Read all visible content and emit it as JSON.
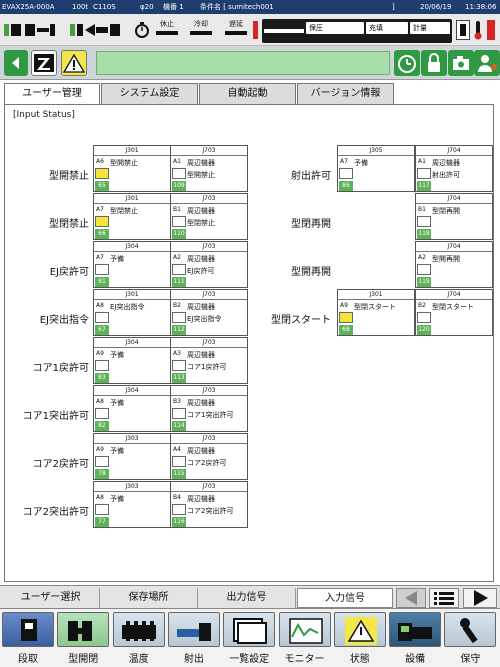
{
  "titlebar": {
    "model": "EVAX25A-000A",
    "size": "100t",
    "controller": "C110S",
    "screw": "φ20",
    "machine": "機番 1",
    "condition": "条件名 [ sumitech001",
    "bracket": "]",
    "date": "20/06/19",
    "time": "11:38:06"
  },
  "status": {
    "process": {
      "pause": "休止",
      "cool": "冷却",
      "delay": "遅延"
    },
    "modes": {
      "hold": "保圧",
      "fill": "充填",
      "meter": "計量"
    }
  },
  "toolbar": {
    "message": "",
    "icons": [
      "back-arrow-icon",
      "z-logo-icon",
      "warning-icon",
      "clock-icon",
      "lock-icon",
      "camera-icon",
      "user-icon"
    ]
  },
  "tabs": [
    {
      "label": "ユーザー管理",
      "active": true
    },
    {
      "label": "システム設定",
      "active": false
    },
    {
      "label": "自動起動",
      "active": false
    },
    {
      "label": "バージョン情報",
      "active": false
    }
  ],
  "section_title": "[Input Status]",
  "rows_left": [
    {
      "label": "型開禁止",
      "a": {
        "conn": "J301",
        "pin": "A6",
        "name": "型開禁止",
        "on": true,
        "num": "65",
        "sub": ""
      },
      "b": {
        "conn": "J703",
        "pin": "A1",
        "name": "周辺機器",
        "on": false,
        "num": "109",
        "sub": "型開禁止"
      }
    },
    {
      "label": "型閉禁止",
      "a": {
        "conn": "J301",
        "pin": "A7",
        "name": "型閉禁止",
        "on": true,
        "num": "66",
        "sub": ""
      },
      "b": {
        "conn": "J703",
        "pin": "B1",
        "name": "周辺機器",
        "on": false,
        "num": "110",
        "sub": "型閉禁止"
      }
    },
    {
      "label": "EJ戻許可",
      "a": {
        "conn": "J304",
        "pin": "A7",
        "name": "予備",
        "on": false,
        "num": "81",
        "sub": ""
      },
      "b": {
        "conn": "J703",
        "pin": "A2",
        "name": "周辺機器",
        "on": false,
        "num": "111",
        "sub": "EJ戻許可"
      }
    },
    {
      "label": "EJ突出指令",
      "a": {
        "conn": "J301",
        "pin": "A8",
        "name": "EJ突出指令",
        "on": false,
        "num": "67",
        "sub": ""
      },
      "b": {
        "conn": "J703",
        "pin": "B2",
        "name": "周辺機器",
        "on": false,
        "num": "112",
        "sub": "EJ突出指令"
      }
    },
    {
      "label": "コア1戻許可",
      "a": {
        "conn": "J304",
        "pin": "A9",
        "name": "予備",
        "on": false,
        "num": "83",
        "sub": ""
      },
      "b": {
        "conn": "J703",
        "pin": "A3",
        "name": "周辺機器",
        "on": false,
        "num": "113",
        "sub": "コア1戻許可"
      }
    },
    {
      "label": "コア1突出許可",
      "a": {
        "conn": "J304",
        "pin": "A8",
        "name": "予備",
        "on": false,
        "num": "82",
        "sub": ""
      },
      "b": {
        "conn": "J703",
        "pin": "B3",
        "name": "周辺機器",
        "on": false,
        "num": "114",
        "sub": "コア1突出許可"
      }
    },
    {
      "label": "コア2戻許可",
      "a": {
        "conn": "J303",
        "pin": "A9",
        "name": "予備",
        "on": false,
        "num": "78",
        "sub": ""
      },
      "b": {
        "conn": "J703",
        "pin": "A4",
        "name": "周辺機器",
        "on": false,
        "num": "115",
        "sub": "コア2戻許可"
      }
    },
    {
      "label": "コア2突出許可",
      "a": {
        "conn": "J303",
        "pin": "A8",
        "name": "予備",
        "on": false,
        "num": "77",
        "sub": ""
      },
      "b": {
        "conn": "J703",
        "pin": "B4",
        "name": "周辺機器",
        "on": false,
        "num": "116",
        "sub": "コア2突出許可"
      }
    }
  ],
  "rows_right": [
    {
      "label": "射出許可",
      "a": {
        "conn": "J305",
        "pin": "A7",
        "name": "予備",
        "on": false,
        "num": "86",
        "sub": ""
      },
      "b": {
        "conn": "J704",
        "pin": "A1",
        "name": "周辺機器",
        "on": false,
        "num": "117",
        "sub": "射出許可"
      }
    },
    {
      "label": "型閉再開",
      "a": null,
      "b": {
        "conn": "J704",
        "pin": "B1",
        "name": "型閉再開",
        "on": false,
        "num": "118",
        "sub": ""
      }
    },
    {
      "label": "型開再開",
      "a": null,
      "b": {
        "conn": "J704",
        "pin": "A2",
        "name": "型開再開",
        "on": false,
        "num": "119",
        "sub": ""
      }
    },
    {
      "label": "型閉スタート",
      "a": {
        "conn": "J301",
        "pin": "A9",
        "name": "型閉スタート",
        "on": true,
        "num": "68",
        "sub": ""
      },
      "b": {
        "conn": "J704",
        "pin": "B2",
        "name": "型閉スタート",
        "on": false,
        "num": "120",
        "sub": ""
      }
    }
  ],
  "subtabs": [
    {
      "label": "ユーザー選択",
      "active": false
    },
    {
      "label": "保存場所",
      "active": false
    },
    {
      "label": "出力信号",
      "active": false
    },
    {
      "label": "入力信号",
      "active": true
    }
  ],
  "fkeys": [
    {
      "label": "段取",
      "icon": "setup-icon",
      "style": "on"
    },
    {
      "label": "型開閉",
      "icon": "mold-icon",
      "style": "green"
    },
    {
      "label": "温度",
      "icon": "heater-icon",
      "style": ""
    },
    {
      "label": "射出",
      "icon": "injection-icon",
      "style": ""
    },
    {
      "label": "一覧設定",
      "icon": "list-icon",
      "style": ""
    },
    {
      "label": "モニター",
      "icon": "monitor-icon",
      "style": ""
    },
    {
      "label": "状態",
      "icon": "warning-icon",
      "style": ""
    },
    {
      "label": "設備",
      "icon": "equipment-icon",
      "style": "dark"
    },
    {
      "label": "保守",
      "icon": "wrench-icon",
      "style": ""
    }
  ]
}
